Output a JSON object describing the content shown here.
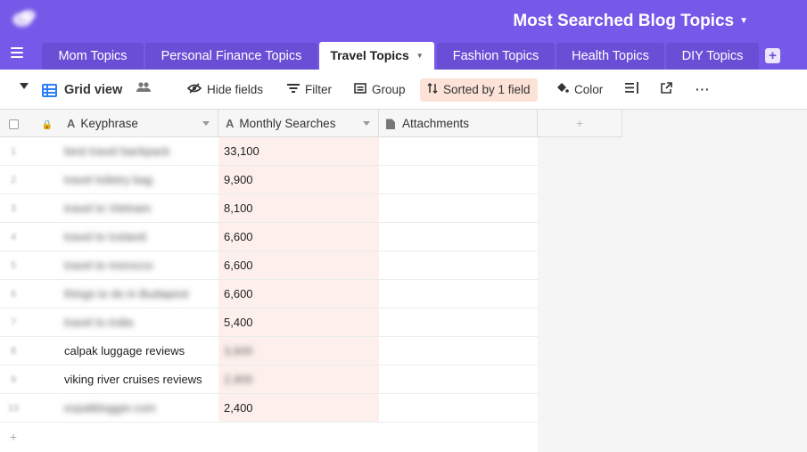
{
  "header": {
    "base_title": "Most Searched Blog Topics",
    "accent_color": "#7659e8"
  },
  "tabs": [
    {
      "label": "Mom Topics",
      "active": false
    },
    {
      "label": "Personal Finance Topics",
      "active": false
    },
    {
      "label": "Travel Topics",
      "active": true
    },
    {
      "label": "Fashion Topics",
      "active": false
    },
    {
      "label": "Health Topics",
      "active": false
    },
    {
      "label": "DIY Topics",
      "active": false
    }
  ],
  "toolbar": {
    "view_name": "Grid view",
    "hide_fields": "Hide fields",
    "filter": "Filter",
    "group": "Group",
    "sorted": "Sorted by 1 field",
    "color": "Color"
  },
  "columns": {
    "keyphrase": "Keyphrase",
    "monthly_searches": "Monthly Searches",
    "attachments": "Attachments"
  },
  "rows": [
    {
      "num": "1",
      "keyphrase": "best travel backpack",
      "searches": "33,100",
      "kp_blurred": true,
      "ms_blurred": false
    },
    {
      "num": "2",
      "keyphrase": "travel toiletry bag",
      "searches": "9,900",
      "kp_blurred": true,
      "ms_blurred": false
    },
    {
      "num": "3",
      "keyphrase": "travel to Vietnam",
      "searches": "8,100",
      "kp_blurred": true,
      "ms_blurred": false
    },
    {
      "num": "4",
      "keyphrase": "travel to Iceland",
      "searches": "6,600",
      "kp_blurred": true,
      "ms_blurred": false
    },
    {
      "num": "5",
      "keyphrase": "travel to morocco",
      "searches": "6,600",
      "kp_blurred": true,
      "ms_blurred": false
    },
    {
      "num": "6",
      "keyphrase": "things to do in Budapest",
      "searches": "6,600",
      "kp_blurred": true,
      "ms_blurred": false
    },
    {
      "num": "7",
      "keyphrase": "travel to india",
      "searches": "5,400",
      "kp_blurred": true,
      "ms_blurred": false
    },
    {
      "num": "8",
      "keyphrase": "calpak luggage reviews",
      "searches": "3,600",
      "kp_blurred": false,
      "ms_blurred": true
    },
    {
      "num": "9",
      "keyphrase": "viking river cruises reviews",
      "searches": "2,900",
      "kp_blurred": false,
      "ms_blurred": true
    },
    {
      "num": "10",
      "keyphrase": "expatblogger.com",
      "searches": "2,400",
      "kp_blurred": true,
      "ms_blurred": false
    }
  ],
  "add_row_symbol": "+"
}
